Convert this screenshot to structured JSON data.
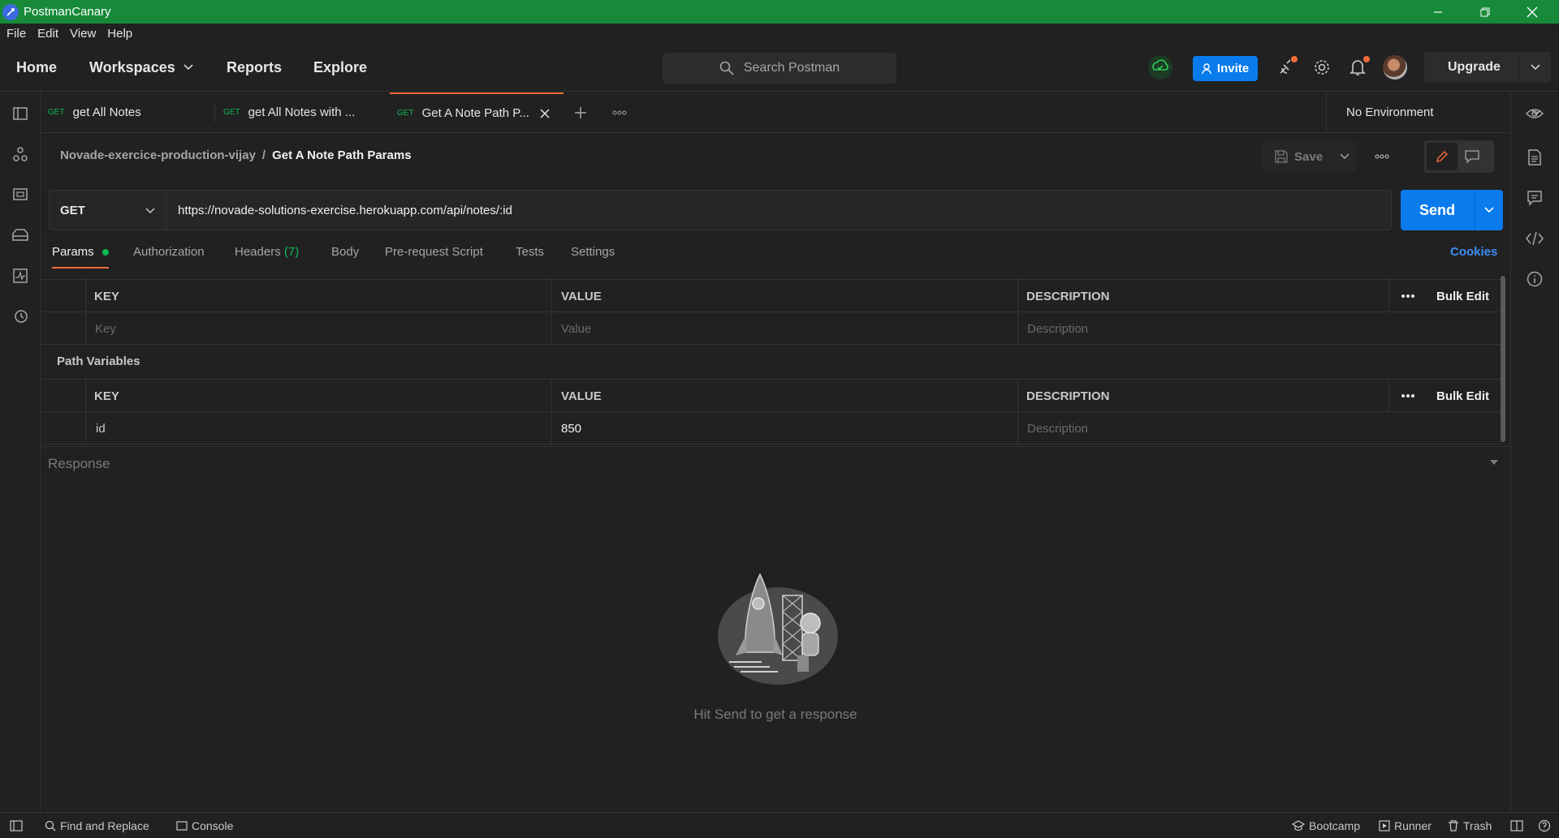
{
  "window": {
    "app_name": "PostmanCanary",
    "title_bar_color": "#178a3a"
  },
  "menu": [
    "File",
    "Edit",
    "View",
    "Help"
  ],
  "header": {
    "nav": {
      "home": "Home",
      "workspaces": "Workspaces",
      "reports": "Reports",
      "explore": "Explore"
    },
    "search_placeholder": "Search Postman",
    "invite_label": "Invite",
    "upgrade_label": "Upgrade",
    "accent_color": "#097bed"
  },
  "tabs": [
    {
      "method": "GET",
      "label": "get All Notes"
    },
    {
      "method": "GET",
      "label": "get All Notes with ..."
    },
    {
      "method": "GET",
      "label": "Get A Note Path P..."
    }
  ],
  "environment": "No Environment",
  "breadcrumb": {
    "collection": "Novade-exercice-production-vijay",
    "separator": "/",
    "request": "Get A Note Path Params"
  },
  "save_label": "Save",
  "request": {
    "method": "GET",
    "url": "https://novade-solutions-exercise.herokuapp.com/api/notes/:id",
    "send_label": "Send"
  },
  "request_tabs": {
    "params": "Params",
    "authorization": "Authorization",
    "headers": "Headers",
    "headers_count": "(7)",
    "body": "Body",
    "prerequest": "Pre-request Script",
    "tests": "Tests",
    "settings": "Settings",
    "cookies": "Cookies"
  },
  "query_params": {
    "columns": {
      "key": "KEY",
      "value": "VALUE",
      "description": "DESCRIPTION"
    },
    "bulk_edit": "Bulk Edit",
    "placeholders": {
      "key": "Key",
      "value": "Value",
      "description": "Description"
    }
  },
  "path_variables": {
    "title": "Path Variables",
    "columns": {
      "key": "KEY",
      "value": "VALUE",
      "description": "DESCRIPTION"
    },
    "bulk_edit": "Bulk Edit",
    "rows": [
      {
        "key": "id",
        "value": "850",
        "description_placeholder": "Description"
      }
    ]
  },
  "response": {
    "label": "Response",
    "empty_message": "Hit Send to get a response"
  },
  "statusbar": {
    "find_replace": "Find and Replace",
    "console": "Console",
    "bootcamp": "Bootcamp",
    "runner": "Runner",
    "trash": "Trash"
  }
}
